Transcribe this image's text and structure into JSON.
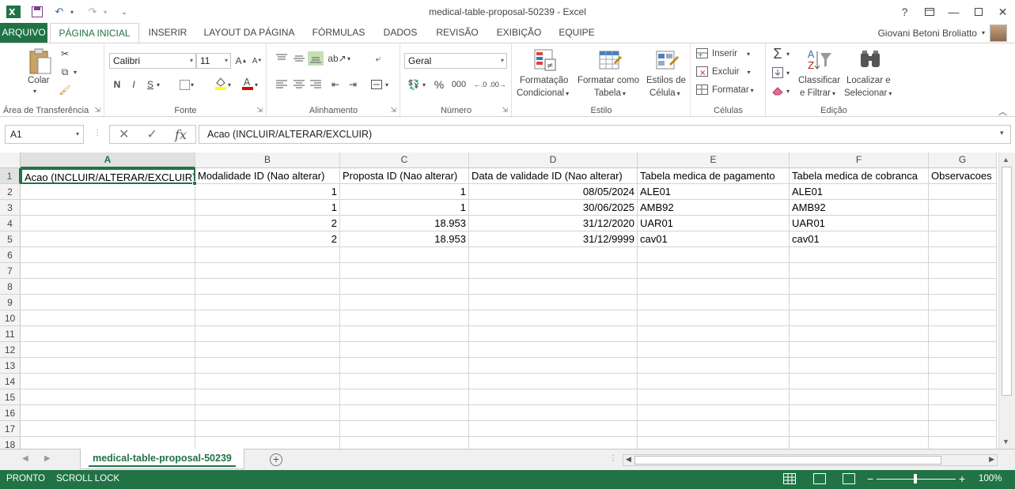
{
  "window": {
    "title": "medical-table-proposal-50239 - Excel",
    "help": "?",
    "user_name": "Giovani Betoni Broliatto"
  },
  "tabs": [
    {
      "label": "ARQUIVO"
    },
    {
      "label": "PÁGINA INICIAL"
    },
    {
      "label": "INSERIR"
    },
    {
      "label": "LAYOUT DA PÁGINA"
    },
    {
      "label": "FÓRMULAS"
    },
    {
      "label": "DADOS"
    },
    {
      "label": "REVISÃO"
    },
    {
      "label": "EXIBIÇÃO"
    },
    {
      "label": "EQUIPE"
    }
  ],
  "ribbon": {
    "clipboard": {
      "label": "Área de Transferência",
      "paste": "Colar"
    },
    "font": {
      "label": "Fonte",
      "name": "Calibri",
      "size": "11",
      "bold": "N",
      "italic": "I",
      "underline": "S"
    },
    "alignment": {
      "label": "Alinhamento"
    },
    "number": {
      "label": "Número",
      "format": "Geral",
      "percent": "%",
      "thousands": "000"
    },
    "styles": {
      "label": "Estilo",
      "cond1": "Formatação",
      "cond2": "Condicional",
      "table1": "Formatar como",
      "table2": "Tabela",
      "cell1": "Estilos de",
      "cell2": "Célula"
    },
    "cells": {
      "label": "Células",
      "insert": "Inserir",
      "delete": "Excluir",
      "format": "Formatar"
    },
    "editing": {
      "label": "Edição",
      "sort1": "Classificar",
      "sort2": "e Filtrar",
      "find1": "Localizar e",
      "find2": "Selecionar"
    }
  },
  "formula_bar": {
    "name_box": "A1",
    "content": "Acao (INCLUIR/ALTERAR/EXCLUIR)"
  },
  "sheet": {
    "columns": [
      "A",
      "B",
      "C",
      "D",
      "E",
      "F",
      "G"
    ],
    "rows": [
      "1",
      "2",
      "3",
      "4",
      "5",
      "6",
      "7",
      "8",
      "9",
      "10",
      "11",
      "12",
      "13",
      "14",
      "15",
      "16",
      "17",
      "18"
    ],
    "headers": [
      "Acao (INCLUIR/ALTERAR/EXCLUIR)",
      "Modalidade ID (Nao alterar)",
      "Proposta ID (Nao alterar)",
      "Data de validade ID (Nao alterar)",
      "Tabela medica de pagamento",
      "Tabela medica de cobranca",
      "Observacoes"
    ],
    "data": [
      [
        "",
        "1",
        "1",
        "08/05/2024",
        "ALE01",
        "ALE01",
        ""
      ],
      [
        "",
        "1",
        "1",
        "30/06/2025",
        "AMB92",
        "AMB92",
        ""
      ],
      [
        "",
        "2",
        "18.953",
        "31/12/2020",
        "UAR01",
        "UAR01",
        ""
      ],
      [
        "",
        "2",
        "18.953",
        "31/12/9999",
        "cav01",
        "cav01",
        ""
      ]
    ]
  },
  "sheet_tab": "medical-table-proposal-50239",
  "status": {
    "ready": "PRONTO",
    "scroll_lock": "SCROLL LOCK",
    "zoom": "100%",
    "zoom_minus": "−",
    "zoom_plus": "+"
  },
  "colors": {
    "accent": "#217346"
  }
}
